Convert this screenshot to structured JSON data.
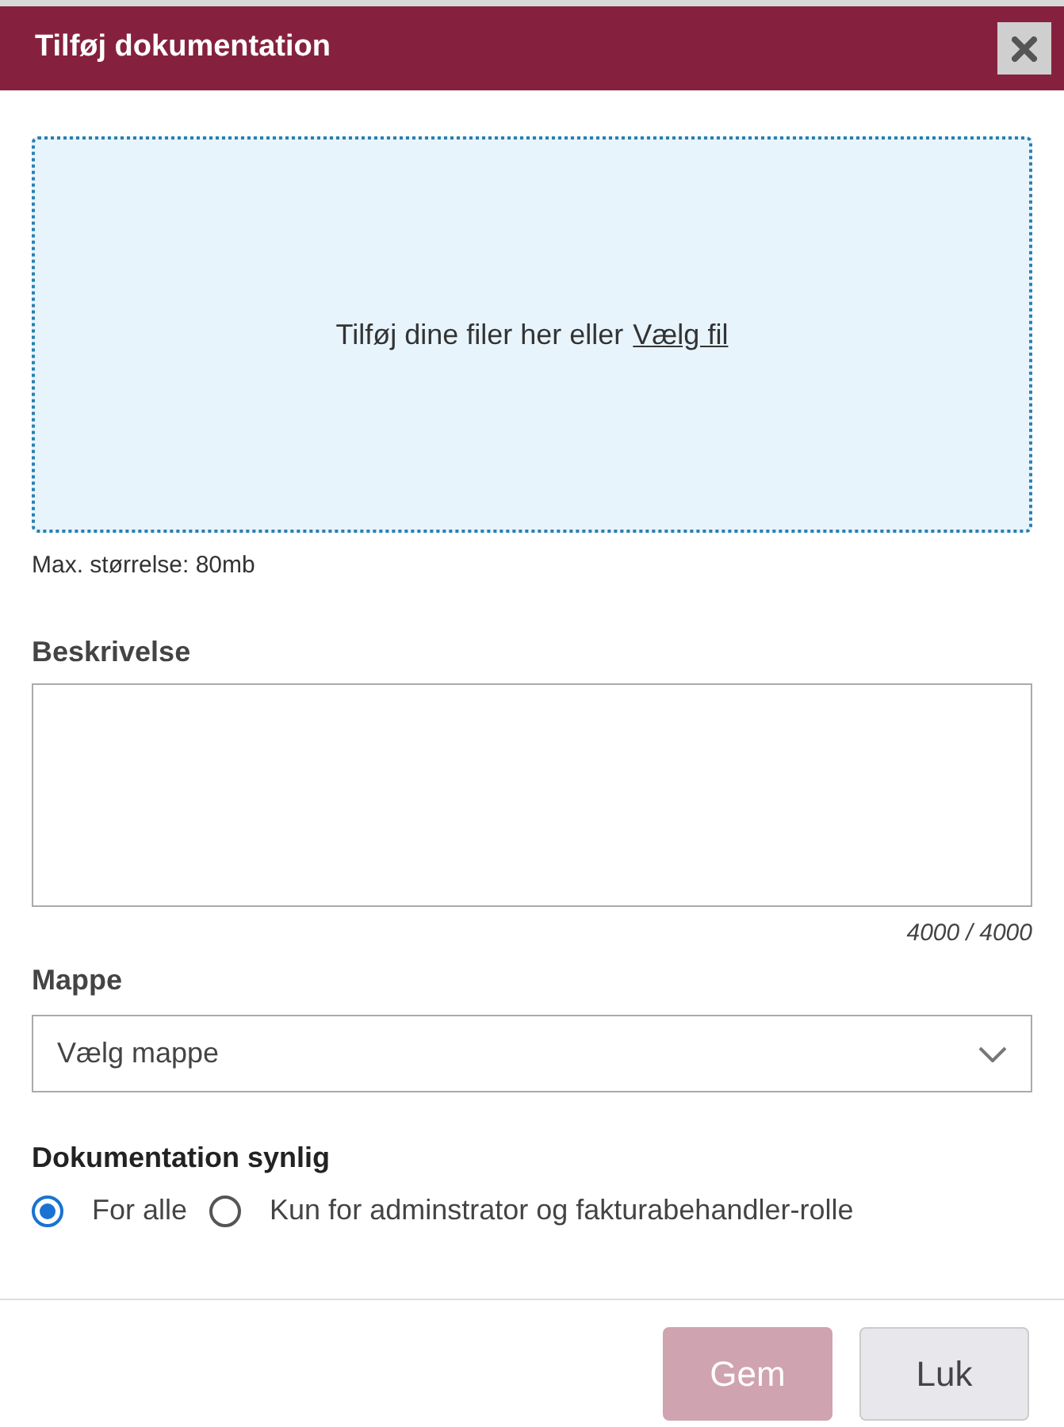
{
  "dialog": {
    "title": "Tilføj dokumentation"
  },
  "dropzone": {
    "text": "Tilføj dine filer her eller",
    "link": "Vælg fil",
    "note": "Max. størrelse: 80mb"
  },
  "description": {
    "label": "Beskrivelse",
    "counter": "4000 / 4000"
  },
  "folder": {
    "label": "Mappe",
    "placeholder": "Vælg mappe"
  },
  "visibility": {
    "label": "Dokumentation synlig",
    "options": [
      {
        "label": "For alle",
        "selected": true
      },
      {
        "label": "Kun for adminstrator og fakturabehandler-rolle",
        "selected": false
      }
    ]
  },
  "buttons": [
    {
      "label": "Gem",
      "kind": "primary",
      "disabled": true
    },
    {
      "label": "Luk",
      "kind": "secondary",
      "disabled": false
    }
  ]
}
